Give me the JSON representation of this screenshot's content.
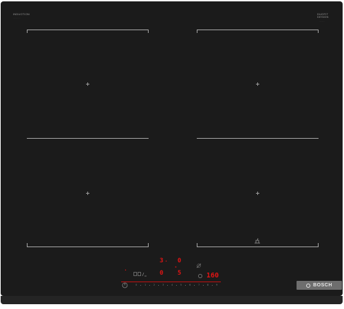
{
  "brand": {
    "top_left_title": "INDUCTION",
    "top_left_sub": "............",
    "top_right_title": "DUOFIT\nDESIGN",
    "top_right_sub": ".........",
    "logo_text": "BOSCH"
  },
  "display": {
    "left_level": "3",
    "left_level_suffix": "•",
    "left_value": "0",
    "right_value": "0",
    "center_digit": "0",
    "center_digit_2": "5",
    "timer_value": "160",
    "small_indicator_1": "•",
    "small_indicator_2": "★"
  },
  "control_scale": {
    "labels": [
      "0",
      "1",
      "2",
      "3",
      "4",
      "5",
      "6",
      "7",
      "8",
      "9"
    ]
  },
  "icons": {
    "power": "power-icon",
    "lock": "lock-icon",
    "pan": "pan-icon",
    "timer": "timer-icon",
    "boost": "boost-icon"
  },
  "colors": {
    "surface": "#1b1b1b",
    "display_red": "#e01414",
    "logo_bg": "#6e6e6e"
  }
}
